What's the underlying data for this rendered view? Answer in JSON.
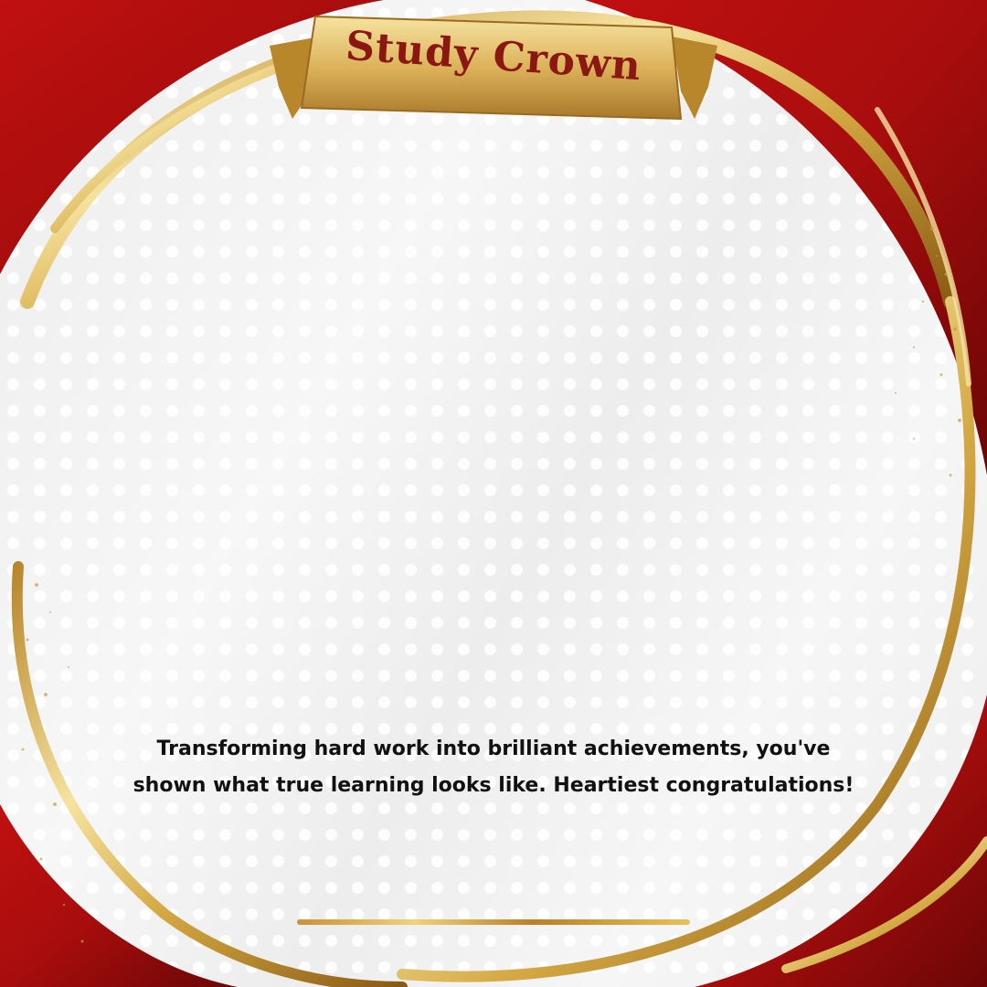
{
  "header": {
    "banner_title": "Study Crown"
  },
  "content": {
    "message_line1": "Transforming hard work into brilliant achievements, you've",
    "message_line2": "shown what true learning looks like. Heartiest congratulations!"
  },
  "theme": {
    "red": "#a80d0d",
    "dark_red": "#6b0606",
    "gold": "#d4a843",
    "light_gold": "#f6e3a0",
    "text": "#111111",
    "banner_text": "#8a1712"
  },
  "decor": {
    "divider_icon": "gold-divider-line",
    "frame_icon": "gold-swirl-frame"
  }
}
